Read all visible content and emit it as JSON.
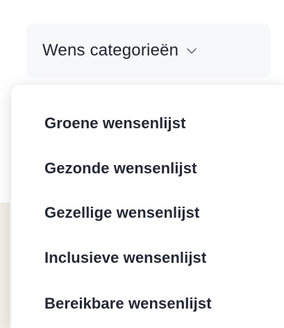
{
  "dropdown": {
    "toggle_label": "Wens categorieën",
    "toggle_icon": "chevron-down-icon",
    "items": [
      {
        "label": "Groene wensenlijst"
      },
      {
        "label": "Gezonde wensenlijst"
      },
      {
        "label": "Gezellige wensenlijst"
      },
      {
        "label": "Inclusieve wensenlijst"
      },
      {
        "label": "Bereikbare wensenlijst"
      }
    ]
  },
  "colors": {
    "toggle_background": "#f7f8fa",
    "text": "#242834",
    "menu_background": "#ffffff"
  }
}
